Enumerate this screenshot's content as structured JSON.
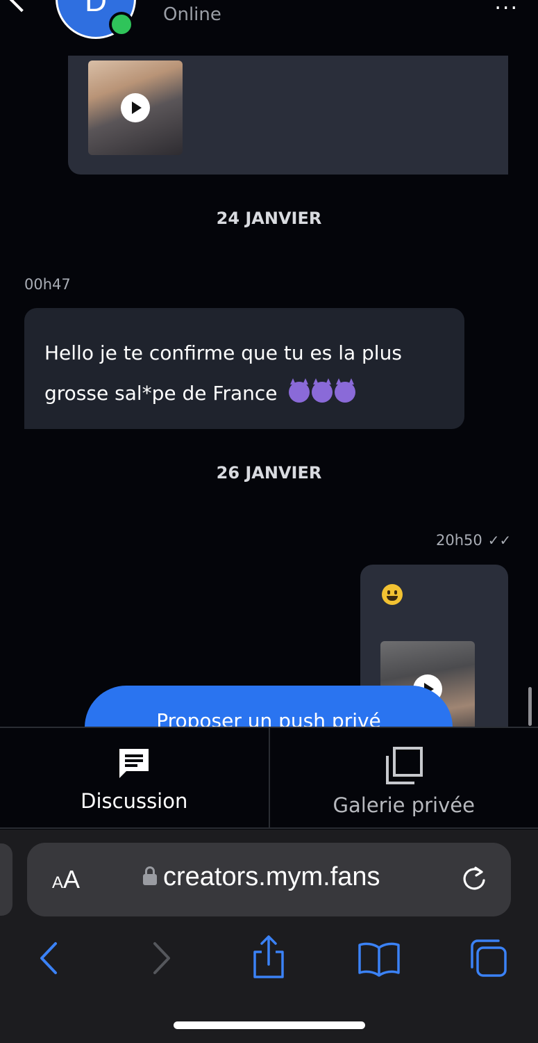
{
  "header": {
    "avatar_initial": "D",
    "status": "Online",
    "more_label": "..."
  },
  "messages": {
    "date_1": "24 JANVIER",
    "incoming_time": "00h47",
    "incoming_text_line1": "Hello je te confirme que tu es la plus",
    "incoming_text_line2": "grosse sal*pe de France",
    "date_2": "26 JANVIER",
    "outgoing_time": "20h50",
    "outgoing_read_check": "✓✓"
  },
  "cta": {
    "push_button_label": "Proposer un push privé"
  },
  "tabs": [
    {
      "label": "Discussion",
      "icon": "chat-icon",
      "active": true
    },
    {
      "label": "Galerie privée",
      "icon": "gallery-icon",
      "active": false
    }
  ],
  "browser": {
    "text_size_small": "A",
    "text_size_big": "A",
    "url": "creators.mym.fans",
    "accent_color": "#3b82f6"
  }
}
